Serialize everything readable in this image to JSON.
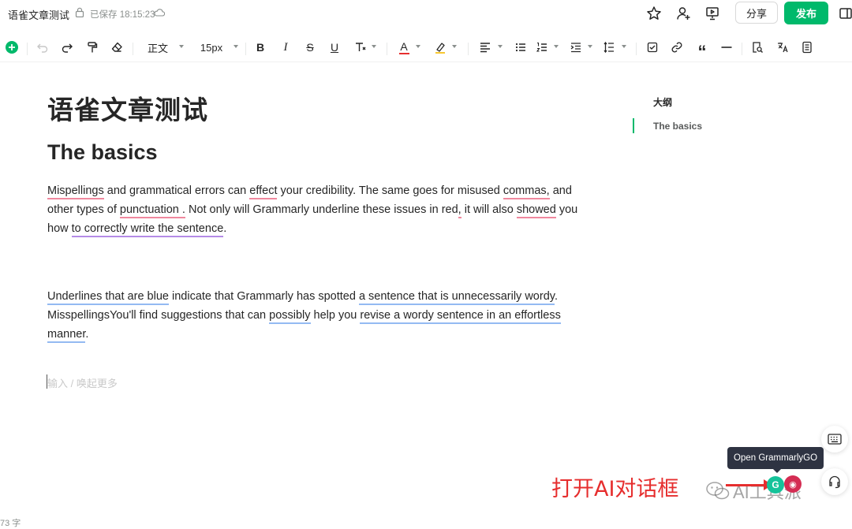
{
  "header": {
    "doc_title": "语雀文章测试",
    "saved_status": "已保存 18:15:23",
    "share_label": "分享",
    "publish_label": "发布"
  },
  "toolbar": {
    "paragraph_style": "正文",
    "font_size": "15px",
    "icons": [
      "add-icon",
      "undo-icon",
      "redo-icon",
      "format-painter-icon",
      "clear-format-icon",
      "bold-icon",
      "italic-icon",
      "strikethrough-icon",
      "underline-icon",
      "more-text-format-icon",
      "font-color-icon",
      "highlight-icon",
      "align-icon",
      "bullet-list-icon",
      "numbered-list-icon",
      "indent-icon",
      "line-spacing-icon",
      "task-list-icon",
      "link-icon",
      "quote-icon",
      "horizontal-rule-icon",
      "find-icon",
      "translate-icon",
      "document-icon"
    ]
  },
  "editor": {
    "title": "语雀文章测试",
    "heading": "The basics",
    "placeholder": "输入 / 唤起更多",
    "p1": {
      "s1": "Mispellings",
      "s2": " and grammatical errors can ",
      "s3": "effect",
      "s4": " your credibility. The same goes for misused ",
      "s5": "commas,",
      "s6": " and other types of ",
      "s7": "punctuation .",
      "s8": " Not only will Grammarly underline these issues in red",
      "s9": ",",
      "s10": " it will also ",
      "s11": "showed",
      "s12": " you how ",
      "s13": "to correctly write the sentence",
      "s14": "."
    },
    "p2": {
      "s1": "Underlines that are blue",
      "s2": " indicate that Grammarly has spotted ",
      "s3": "a sentence that is unnecessarily wordy",
      "s4": ". MisspellingsYou'll find suggestions that can ",
      "s5": "possibly",
      "s6": " help you ",
      "s7": "revise a wordy sentence in an effortless manner",
      "s8": "."
    }
  },
  "outline": {
    "title": "大纲",
    "items": [
      "The basics"
    ]
  },
  "footer": {
    "word_count": "73 字"
  },
  "grammarly": {
    "tooltip": "Open GrammarlyGO",
    "logo_letter": "G"
  },
  "annotation": {
    "text": "打开AI对话框"
  },
  "watermark": "AI工具派",
  "colors": {
    "accent": "#00b96b",
    "error_underline": "#f0889e",
    "clarity_underline": "#b48be6",
    "wordy_underline": "#94baf2",
    "annotation": "#e62e2e"
  }
}
